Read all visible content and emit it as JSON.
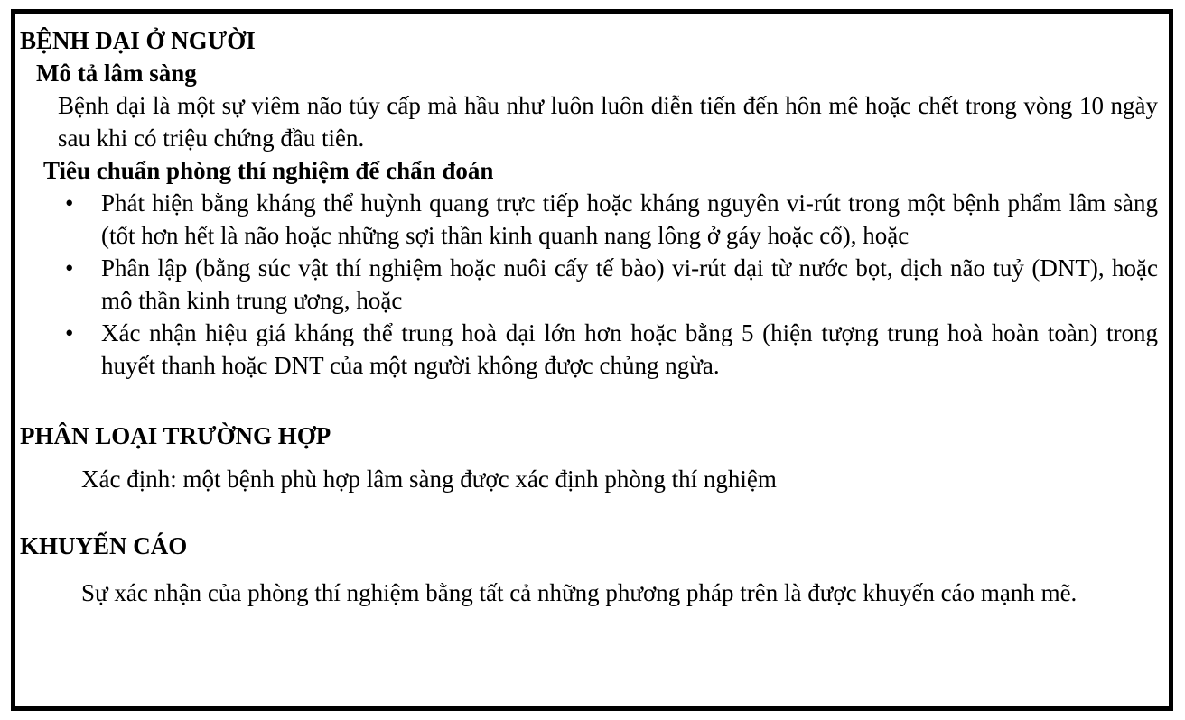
{
  "rabies_section": {
    "heading": "BỆNH DẠI Ở NGƯỜI",
    "clinical_title": "Mô tả lâm sàng",
    "clinical_text": "Bệnh dại là một sự viêm não tủy cấp mà hầu như luôn luôn diễn tiến đến hôn mê hoặc chết trong vòng 10 ngày sau khi có triệu chứng đầu tiên.",
    "lab_title": "Tiêu chuẩn phòng thí nghiệm để chẩn đoán",
    "bullet_symbol": "•",
    "lab_criteria": [
      "Phát hiện bằng kháng thể huỳnh quang trực tiếp hoặc kháng nguyên vi-rút trong một bệnh phẩm lâm sàng (tốt hơn hết là não hoặc những sợi thần kinh quanh nang lông ở gáy hoặc cổ), hoặc",
      "Phân lập (bằng súc vật thí nghiệm hoặc nuôi cấy tế bào) vi-rút dại từ nước bọt, dịch não tuỷ (DNT), hoặc mô thần kinh trung ương, hoặc",
      "Xác nhận hiệu giá kháng thể trung hoà dại lớn hơn hoặc bằng 5 (hiện tượng trung hoà hoàn toàn) trong huyết thanh hoặc DNT của một người không được chủng ngừa."
    ]
  },
  "classification_section": {
    "heading": "PHÂN LOẠI TRƯỜNG HỢP",
    "text": "Xác định: một bệnh phù hợp lâm sàng được xác định phòng thí nghiệm"
  },
  "recommendation_section": {
    "heading": "KHUYẾN CÁO",
    "text": "Sự xác nhận của phòng thí nghiệm bằng tất cả những phương pháp trên là được khuyến cáo mạnh mẽ."
  }
}
